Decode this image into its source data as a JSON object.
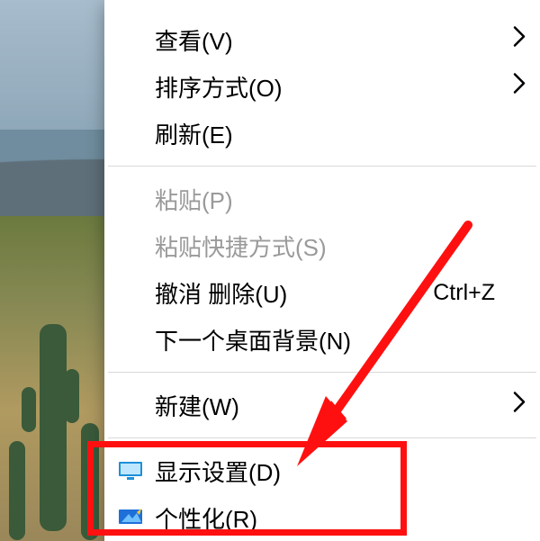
{
  "menu": {
    "view": {
      "label": "查看(V)",
      "has_submenu": true
    },
    "sort": {
      "label": "排序方式(O)",
      "has_submenu": true
    },
    "refresh": {
      "label": "刷新(E)"
    },
    "paste": {
      "label": "粘贴(P)",
      "disabled": true
    },
    "paste_link": {
      "label": "粘贴快捷方式(S)",
      "disabled": true
    },
    "undo": {
      "label": "撤消 删除(U)",
      "shortcut": "Ctrl+Z"
    },
    "next_bg": {
      "label": "下一个桌面背景(N)"
    },
    "new": {
      "label": "新建(W)",
      "has_submenu": true
    },
    "display": {
      "label": "显示设置(D)",
      "icon": "monitor"
    },
    "personalize": {
      "label": "个性化(R)",
      "icon": "personalize"
    }
  },
  "annotation": {
    "highlight_target": "personalize",
    "arrow_color": "#ff1010"
  }
}
